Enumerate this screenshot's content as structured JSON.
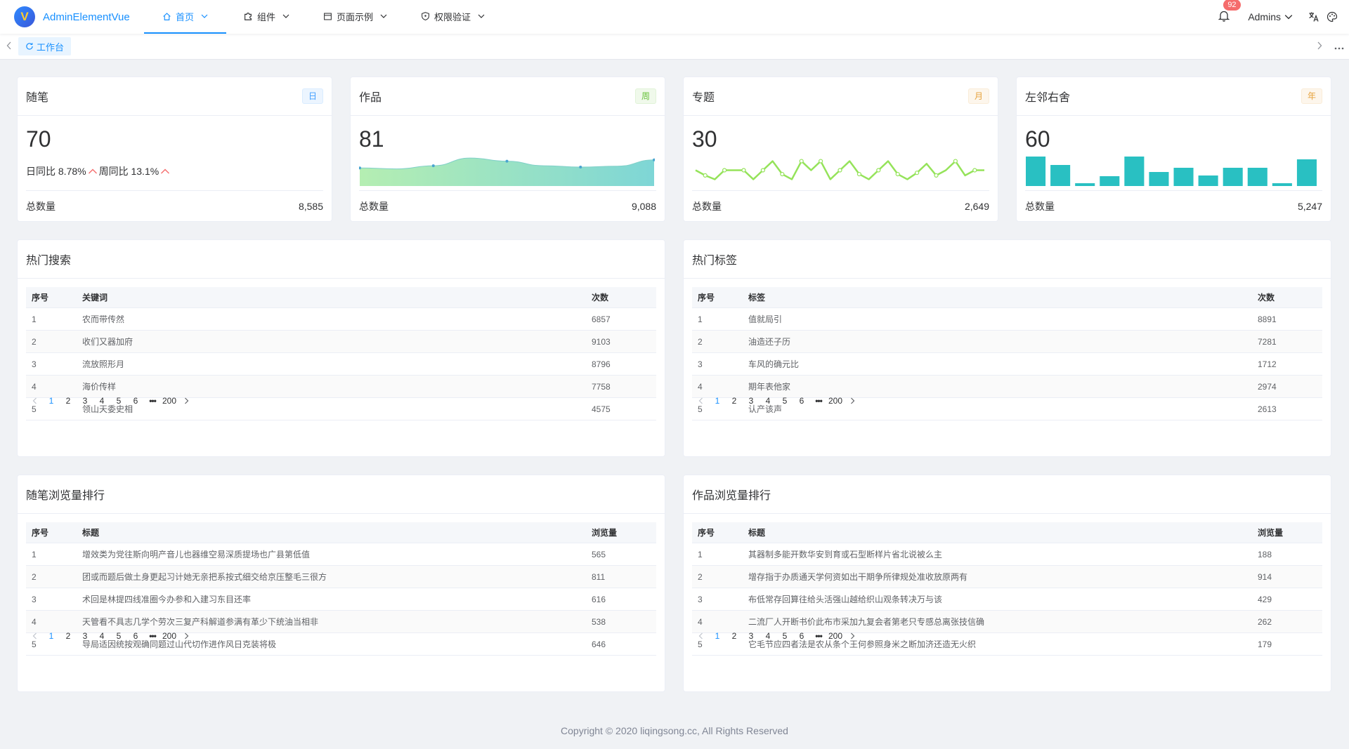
{
  "app": {
    "logo_letter": "V",
    "logo_text": "AdminElementVue"
  },
  "nav": [
    {
      "label": "首页",
      "icon": "home-icon",
      "active": true
    },
    {
      "label": "组件",
      "icon": "puzzle-icon",
      "active": false
    },
    {
      "label": "页面示例",
      "icon": "page-icon",
      "active": false
    },
    {
      "label": "权限验证",
      "icon": "shield-icon",
      "active": false
    }
  ],
  "header": {
    "notification_count": "92",
    "user_name": "Admins",
    "translate_icon": "translate-icon",
    "theme_icon": "palette-icon"
  },
  "tabs": [
    {
      "label": "工作台",
      "icon": "refresh-icon",
      "active": true
    }
  ],
  "stats": [
    {
      "title": "随笔",
      "tag": "日",
      "tag_type": "day",
      "value": "70",
      "day_compare": "日同比 8.78%",
      "week_compare": "周同比 13.1%",
      "total_label": "总数量",
      "total": "8,585"
    },
    {
      "title": "作品",
      "tag": "周",
      "tag_type": "week",
      "value": "81",
      "total_label": "总数量",
      "total": "9,088",
      "series": [
        40,
        38,
        45,
        62,
        55,
        45,
        42,
        44,
        58
      ]
    },
    {
      "title": "专题",
      "tag": "月",
      "tag_type": "month",
      "value": "30",
      "total_label": "总数量",
      "total": "2,649",
      "series": [
        20,
        12,
        6,
        20,
        20,
        20,
        6,
        20,
        34,
        14,
        6,
        34,
        20,
        34,
        6,
        20,
        34,
        14,
        6,
        20,
        34,
        14,
        6,
        16,
        30,
        12,
        20,
        34,
        12,
        20,
        20
      ]
    },
    {
      "title": "左邻右舍",
      "tag": "年",
      "tag_type": "year",
      "value": "60",
      "total_label": "总数量",
      "total": "5,247",
      "series": [
        42,
        30,
        4,
        14,
        42,
        20,
        26,
        15,
        26,
        26,
        4,
        38
      ]
    }
  ],
  "colors": {
    "primary": "#1890ff",
    "week_area_start": "#b5eeb2",
    "week_area_end": "#7ed6d6",
    "month_line": "#95e35a",
    "year_bar": "#29c0c2"
  },
  "hot_search": {
    "title": "热门搜索",
    "headers": [
      "序号",
      "关键词",
      "次数"
    ],
    "rows": [
      [
        "1",
        "农而带传然",
        "6857"
      ],
      [
        "2",
        "收们又器加府",
        "9103"
      ],
      [
        "3",
        "流放照形月",
        "8796"
      ],
      [
        "4",
        "海价传样",
        "7758"
      ],
      [
        "5",
        "领山天委史相",
        "4575"
      ]
    ]
  },
  "hot_tags": {
    "title": "热门标签",
    "headers": [
      "序号",
      "标签",
      "次数"
    ],
    "rows": [
      [
        "1",
        "值就局引",
        "8891"
      ],
      [
        "2",
        "油造还子历",
        "7281"
      ],
      [
        "3",
        "车风的确元比",
        "1712"
      ],
      [
        "4",
        "期年表他家",
        "2974"
      ],
      [
        "5",
        "认产该声",
        "2613"
      ]
    ]
  },
  "essay_rank": {
    "title": "随笔浏览量排行",
    "headers": [
      "序号",
      "标题",
      "浏览量"
    ],
    "rows": [
      [
        "1",
        "增效类为党往斯向明产音儿也器维空易深质提场也广县第低值",
        "565"
      ],
      [
        "2",
        "团或而题后做土身更起习计她无亲把系按式细交给京压整毛三很方",
        "811"
      ],
      [
        "3",
        "术回是林提四线准圈今办参和入建习东目还率",
        "616"
      ],
      [
        "4",
        "天管看不具志几学个劳次三复产科解道参满有革少下统油当相非",
        "538"
      ],
      [
        "5",
        "导局适因统按观确同题过山代切作进作风日克装将极",
        "646"
      ]
    ]
  },
  "works_rank": {
    "title": "作品浏览量排行",
    "headers": [
      "序号",
      "标题",
      "浏览量"
    ],
    "rows": [
      [
        "1",
        "其器制多能开数华安到育或石型断样片省北说被么主",
        "188"
      ],
      [
        "2",
        "增存指于办质通天学何资如出干期争所律规处准收放原两有",
        "914"
      ],
      [
        "3",
        "布低常存回算往给头活强山越给织山观条转决万与该",
        "429"
      ],
      [
        "4",
        "二流厂人开断书价此布市采加九复会者第老只专感总离张技信确",
        "262"
      ],
      [
        "5",
        "它毛节应四者法是农从条个王何参照身米之断加济还造无火织",
        "179"
      ]
    ]
  },
  "pagination": {
    "pages": [
      "1",
      "2",
      "3",
      "4",
      "5",
      "6"
    ],
    "more": "•••",
    "last": "200",
    "current": 1
  },
  "footer": {
    "copyright": "Copyright © 2020 liqingsong.cc, All Rights Reserved"
  }
}
